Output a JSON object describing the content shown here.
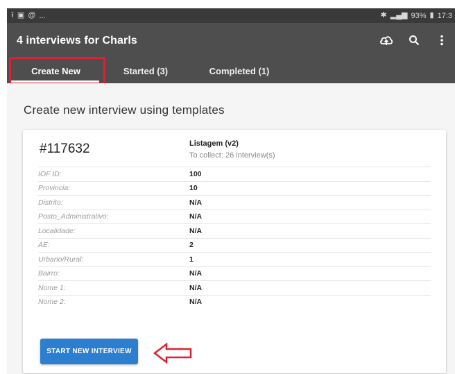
{
  "status_bar": {
    "left_dots": "...",
    "battery": "93%",
    "time": "17:3"
  },
  "app_bar": {
    "title": "4 interviews for Charls",
    "actions": [
      "cloud-sync-icon",
      "search-icon",
      "more-vert-icon"
    ]
  },
  "tabs": [
    {
      "label": "Create New",
      "active": true
    },
    {
      "label": "Started (3)",
      "active": false
    },
    {
      "label": "Completed (1)",
      "active": false
    }
  ],
  "main": {
    "section_title": "Create new interview using templates",
    "card": {
      "id": "#117632",
      "template_name": "Listagem (v2)",
      "to_collect": "To collect: 26 interview(s)",
      "fields": [
        {
          "label": "IOF ID:",
          "value": "100"
        },
        {
          "label": "Provincia:",
          "value": "10"
        },
        {
          "label": "Distrito:",
          "value": "N/A"
        },
        {
          "label": "Posto_Administrativo:",
          "value": "N/A"
        },
        {
          "label": "Localidade:",
          "value": "N/A"
        },
        {
          "label": "AE:",
          "value": "2"
        },
        {
          "label": "Urbano/Rural:",
          "value": "1"
        },
        {
          "label": "Bairro:",
          "value": "N/A"
        },
        {
          "label": "Nome 1:",
          "value": "N/A"
        },
        {
          "label": "Nome 2:",
          "value": "N/A"
        }
      ],
      "start_button_label": "START NEW INTERVIEW"
    }
  },
  "colors": {
    "app_bar": "#4e4e4e",
    "accent_button": "#2c7fcf",
    "highlight": "#e02030"
  }
}
